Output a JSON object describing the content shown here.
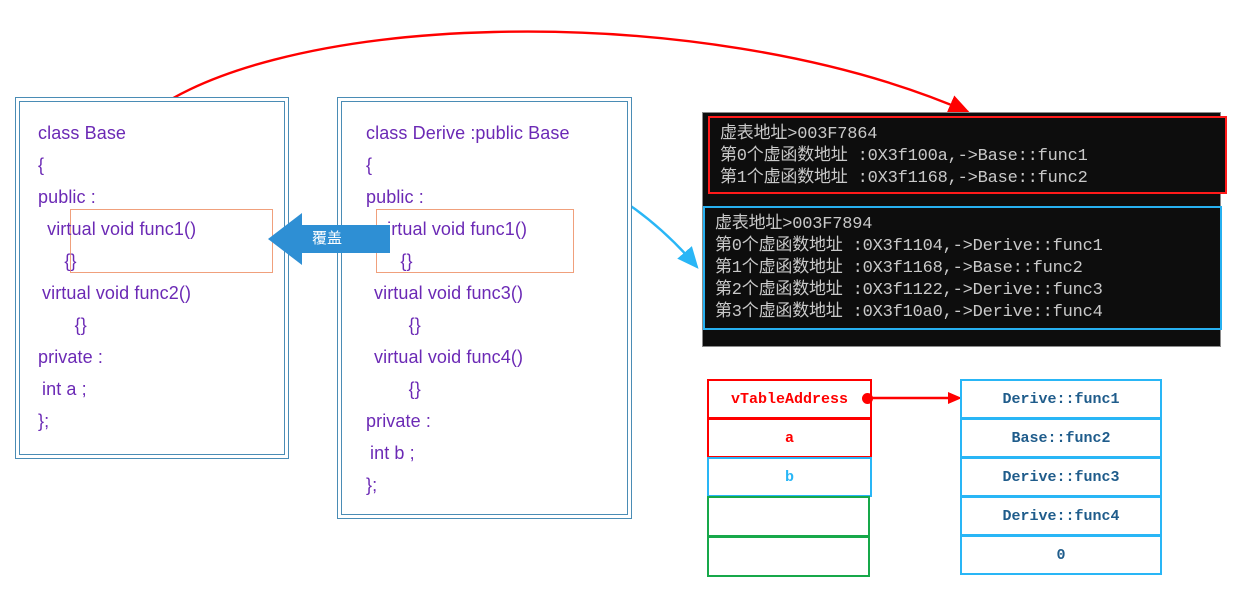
{
  "diagram": {
    "title_hidden": "",
    "base_class": {
      "name": "class-base-box",
      "lines": [
        "class Base",
        "{",
        "public :",
        " virtual void func1()",
        "    {}",
        "virtual void func2()",
        "      {}",
        "private :",
        "int a ;",
        "};"
      ]
    },
    "derive_class": {
      "name": "class-derive-box",
      "lines": [
        "class Derive :public Base",
        "{",
        "public :",
        "virtual void func1()",
        "    {}",
        "virtual void func3()",
        "      {}",
        "virtual void func4()",
        "      {}",
        "private :",
        "int b ;",
        "};"
      ]
    },
    "override_arrow": {
      "label": "覆盖"
    },
    "console": {
      "base_output": {
        "border_color": "#ff1a1a",
        "lines": [
          "虚表地址>003F7864",
          "第0个虚函数地址 :0X3f100a,->Base::func1",
          "第1个虚函数地址 :0X3f1168,->Base::func2"
        ]
      },
      "derive_output": {
        "border_color": "#27b0f0",
        "lines": [
          "虚表地址>003F7894",
          "第0个虚函数地址 :0X3f1104,->Derive::func1",
          "第1个虚函数地址 :0X3f1168,->Base::func2",
          "第2个虚函数地址 :0X3f1122,->Derive::func3",
          "第3个虚函数地址 :0X3f10a0,->Derive::func4"
        ]
      }
    },
    "object_layout": {
      "name": "derive-object-layout",
      "cells": [
        {
          "label": "vTableAddress",
          "color": "red"
        },
        {
          "label": "a",
          "color": "red"
        },
        {
          "label": "b",
          "color": "cyan"
        },
        {
          "label": "",
          "color": "green"
        },
        {
          "label": "",
          "color": "green"
        }
      ]
    },
    "vtable": {
      "name": "derive-vtable",
      "cells": [
        {
          "label": "Derive::func1"
        },
        {
          "label": "Base::func2"
        },
        {
          "label": "Derive::func3"
        },
        {
          "label": "Derive::func4"
        },
        {
          "label": "0"
        }
      ]
    },
    "colors": {
      "code_text": "#6b29b5",
      "class_border": "#4a8cb5",
      "highlight": "#f0a07c",
      "red": "#ff0000",
      "cyan": "#29b6f6",
      "green": "#17a84a",
      "vtable_text": "#1f5c8b",
      "arrow_blue": "#2e8fd4",
      "console_bg": "#0d0d0d",
      "console_text": "#c9c9c9"
    }
  }
}
